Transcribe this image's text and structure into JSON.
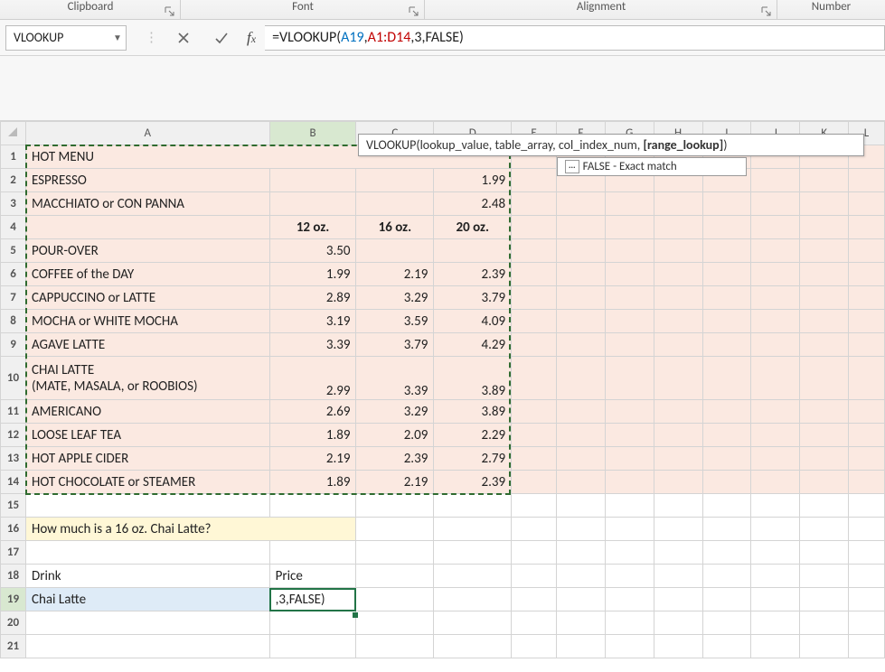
{
  "ribbon": {
    "groups": [
      "Clipboard",
      "Font",
      "Alignment",
      "Number"
    ]
  },
  "nameBox": "VLOOKUP",
  "formula": {
    "pre": "=VLOOKUP(",
    "ref1": "A19",
    "mid1": ",",
    "ref2": "A1:D14",
    "mid2": ",3,FALSE",
    "post": ")"
  },
  "tooltip": {
    "text": "VLOOKUP(lookup_value, table_array, col_index_num, ",
    "bold": "[range_lookup]",
    "close": ")"
  },
  "intelli": "FALSE - Exact match",
  "colHeaders": [
    "A",
    "B",
    "C",
    "D",
    "E",
    "F",
    "G",
    "H",
    "I",
    "J",
    "K",
    "L"
  ],
  "rows": [
    {
      "n": "1",
      "A": "HOT MENU"
    },
    {
      "n": "2",
      "A": "ESPRESSO",
      "D": "1.99"
    },
    {
      "n": "3",
      "A": "MACCHIATO or CON PANNA",
      "D": "2.48"
    },
    {
      "n": "4",
      "B": "12 oz.",
      "C": "16 oz.",
      "D": "20 oz."
    },
    {
      "n": "5",
      "A": "POUR-OVER",
      "B": "3.50"
    },
    {
      "n": "6",
      "A": "COFFEE of the DAY",
      "B": "1.99",
      "C": "2.19",
      "D": "2.39"
    },
    {
      "n": "7",
      "A": "CAPPUCCINO or LATTE",
      "B": "2.89",
      "C": "3.29",
      "D": "3.79"
    },
    {
      "n": "8",
      "A": "MOCHA or WHITE MOCHA",
      "B": "3.19",
      "C": "3.59",
      "D": "4.09"
    },
    {
      "n": "9",
      "A": "AGAVE LATTE",
      "B": "3.39",
      "C": "3.79",
      "D": "4.29"
    },
    {
      "n": "10",
      "A": "CHAI LATTE\n(MATE, MASALA, or ROOBIOS)",
      "B": "2.99",
      "C": "3.39",
      "D": "3.89"
    },
    {
      "n": "11",
      "A": "AMERICANO",
      "B": "2.69",
      "C": "3.29",
      "D": "3.89"
    },
    {
      "n": "12",
      "A": "LOOSE LEAF TEA",
      "B": "1.89",
      "C": "2.09",
      "D": "2.29"
    },
    {
      "n": "13",
      "A": "HOT APPLE CIDER",
      "B": "2.19",
      "C": "2.39",
      "D": "2.79"
    },
    {
      "n": "14",
      "A": "HOT CHOCOLATE or STEAMER",
      "B": "1.89",
      "C": "2.19",
      "D": "2.39"
    },
    {
      "n": "15"
    },
    {
      "n": "16",
      "A": "How much is a 16 oz. Chai Latte?"
    },
    {
      "n": "17"
    },
    {
      "n": "18",
      "A": "Drink",
      "B": "Price"
    },
    {
      "n": "19",
      "A": "Chai Latte",
      "B": ",3,FALSE)"
    },
    {
      "n": "20"
    },
    {
      "n": "21"
    }
  ]
}
